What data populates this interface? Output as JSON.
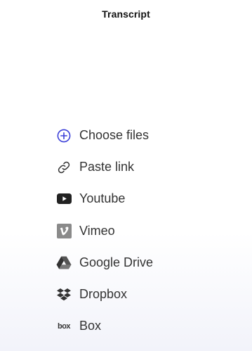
{
  "header": {
    "title": "Transcript"
  },
  "sources": [
    {
      "label": "Choose files",
      "icon": "plus-circle-icon"
    },
    {
      "label": "Paste link",
      "icon": "link-icon"
    },
    {
      "label": "Youtube",
      "icon": "youtube-icon"
    },
    {
      "label": "Vimeo",
      "icon": "vimeo-icon"
    },
    {
      "label": "Google Drive",
      "icon": "google-drive-icon"
    },
    {
      "label": "Dropbox",
      "icon": "dropbox-icon"
    },
    {
      "label": "Box",
      "icon": "box-icon",
      "icon_text": "box"
    }
  ],
  "colors": {
    "accent": "#3b3fd8",
    "text": "#333333",
    "title": "#111111"
  }
}
